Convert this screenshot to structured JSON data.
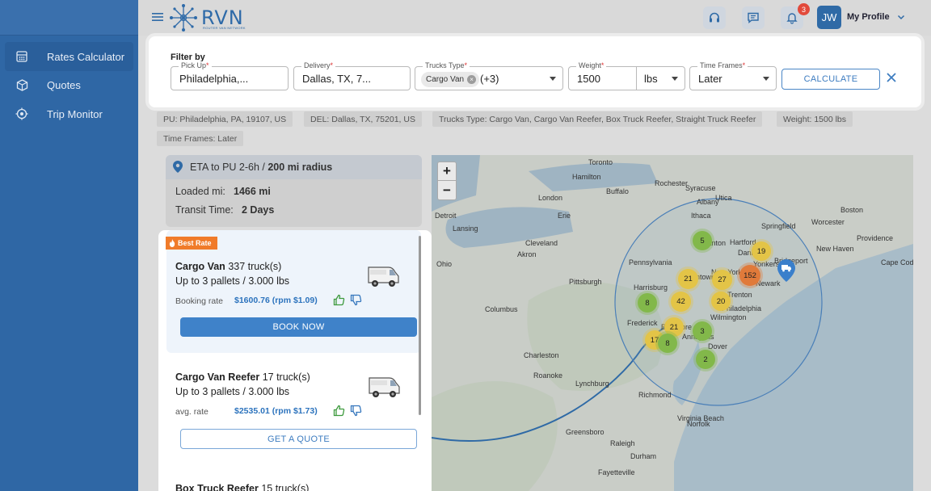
{
  "brand": {
    "name": "RVN",
    "tagline": "ROUTER VAN NETWORK"
  },
  "sidebar": {
    "items": [
      {
        "label": "Rates Calculator",
        "icon": "calculator-icon",
        "active": true
      },
      {
        "label": "Quotes",
        "icon": "box-icon",
        "active": false
      },
      {
        "label": "Trip Monitor",
        "icon": "location-target-icon",
        "active": false
      }
    ]
  },
  "header": {
    "notifications_count": "3",
    "avatar_initials": "JW",
    "profile_label": "My Profile"
  },
  "filter": {
    "title": "Filter by",
    "pickup": {
      "label": "Pick Up",
      "value": "Philadelphia,..."
    },
    "delivery": {
      "label": "Delivery",
      "value": "Dallas, TX, 7..."
    },
    "trucks": {
      "label": "Trucks Type",
      "chip": "Cargo Van",
      "more": "(+3)"
    },
    "weight": {
      "label": "Weight",
      "value": "1500",
      "unit": "lbs"
    },
    "time": {
      "label": "Time Frames",
      "value": "Later"
    },
    "calculate_label": "CALCULATE"
  },
  "summary": {
    "pu": "PU: Philadelphia, PA, 19107, US",
    "del": "DEL: Dallas, TX, 75201, US",
    "trucks": "Trucks Type: Cargo Van, Cargo Van Reefer, Box Truck Reefer, Straight Truck Reefer",
    "weight": "Weight: 1500 lbs",
    "time": "Time Frames: Later"
  },
  "eta": {
    "line_prefix": "ETA to PU 2-6h /",
    "line_bold": "200 mi radius",
    "loaded_label": "Loaded mi:",
    "loaded_value": "1466 mi",
    "transit_label": "Transit Time:",
    "transit_value": "2 Days"
  },
  "results": [
    {
      "tag": "Best Rate",
      "name": "Cargo Van",
      "count": "337 truck(s)",
      "capacity": "Up to 3 pallets / 3.000 lbs",
      "rate_label": "Booking rate",
      "rate": "$1600.76 (rpm $1.09)",
      "action": "BOOK NOW"
    },
    {
      "name": "Cargo Van Reefer",
      "count": "17 truck(s)",
      "capacity": "Up to 3 pallets / 3.000 lbs",
      "rate_label": "avg. rate",
      "rate": "$2535.01 (rpm $1.73)",
      "action": "GET A QUOTE"
    },
    {
      "name": "Box Truck Reefer",
      "count": "15 truck(s)"
    }
  ],
  "map": {
    "zoom_in": "+",
    "zoom_out": "−",
    "clusters": [
      "5",
      "19",
      "152",
      "21",
      "27",
      "8",
      "42",
      "20",
      "21",
      "3",
      "17",
      "8",
      "2"
    ],
    "cities": [
      "Toronto",
      "Hamilton",
      "Buffalo",
      "London",
      "Cleveland",
      "Columbus",
      "Pittsburgh",
      "Harrisburg",
      "Philadelphia",
      "Charleston",
      "Richmond",
      "Virginia Beach",
      "Raleigh",
      "Boston",
      "Springfield",
      "Hartford",
      "Bridgeport",
      "New Haven",
      "Newark",
      "New York",
      "Danbury",
      "Yonkers",
      "Albany",
      "Pennsylvania",
      "Ohio",
      "Frederick",
      "Baltimore",
      "Annapolis",
      "Wilmington",
      "Detroit",
      "Rochester",
      "Lansing",
      "Syracuse",
      "Scranton",
      "Allentown",
      "Trenton",
      "Dover",
      "Lynchburg",
      "Roanoke",
      "Greensboro",
      "Norfolk",
      "Akron",
      "Erie",
      "Ithaca",
      "Utica",
      "Worcester",
      "Providence",
      "Durham",
      "Fayetteville",
      "Cape Cod"
    ]
  },
  "colors": {
    "primary": "#2f67a5",
    "accent": "#3f82c9",
    "best_rate": "#f07b2a",
    "cluster_green": "#7cb342",
    "cluster_yellow": "#e6c341",
    "cluster_orange": "#e07a3a"
  }
}
